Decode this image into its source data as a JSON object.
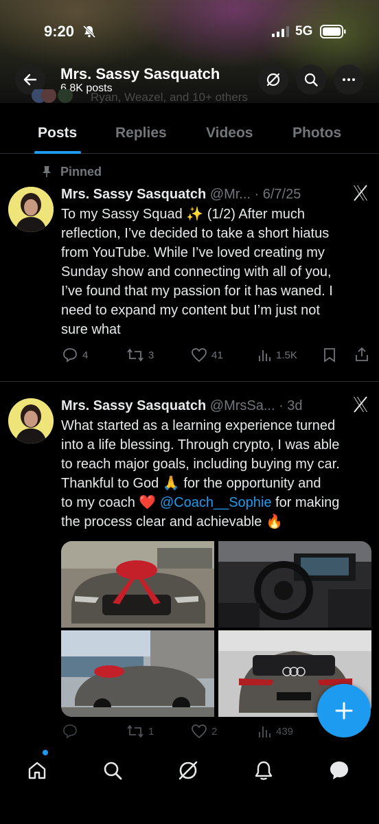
{
  "status_bar": {
    "time": "9:20",
    "network": "5G"
  },
  "profile": {
    "name": "Mrs. Sassy Sasquatch",
    "posts_count": "6.8K posts"
  },
  "followers_peek": "Ryan, Weazel, and 10+ others",
  "tabs": [
    {
      "label": "Posts",
      "active": true
    },
    {
      "label": "Replies",
      "active": false
    },
    {
      "label": "Videos",
      "active": false
    },
    {
      "label": "Photos",
      "active": false
    }
  ],
  "posts": [
    {
      "pinned_label": "Pinned",
      "author": "Mrs. Sassy Sasquatch",
      "handle_date": "@Mr... · 6/7/25",
      "text_lines": [
        "To my Sassy Squad ✨  (1/2) After much",
        "reflection, I’ve decided to take a short hiatus",
        "from YouTube. While I’ve loved creating my",
        "Sunday show and connecting with all of you,",
        "I’ve found that my passion for it has waned.  I",
        "need to expand my content  but I’m just not",
        "sure what"
      ],
      "replies": "4",
      "reposts": "3",
      "likes": "41",
      "views": "1.5K"
    },
    {
      "author": "Mrs. Sassy Sasquatch",
      "handle_date": "@MrsSa... · 3d",
      "text_lines": [
        "What started as a learning experience turned",
        "into a life blessing. Through crypto, I was able",
        "to reach major goals, including buying my car.",
        "Thankful to God 🙏  for the opportunity and"
      ],
      "line5_pre": "to my coach ❤️ ",
      "mention": "@Coach__Sophie",
      "line5_post": " for making",
      "line6": "the process clear and achievable 🔥",
      "replies": "",
      "reposts": "1",
      "likes": "2",
      "views": "439"
    }
  ],
  "icons": {
    "back": "back-arrow-icon",
    "grok": "grok-icon",
    "search": "search-icon",
    "more": "more-icon",
    "x_logo": "x-logo-icon",
    "compose": "plus-icon"
  },
  "colors": {
    "accent": "#1d9bf0",
    "bg": "#000000",
    "muted": "#71767b",
    "text": "#e7e9ea"
  }
}
